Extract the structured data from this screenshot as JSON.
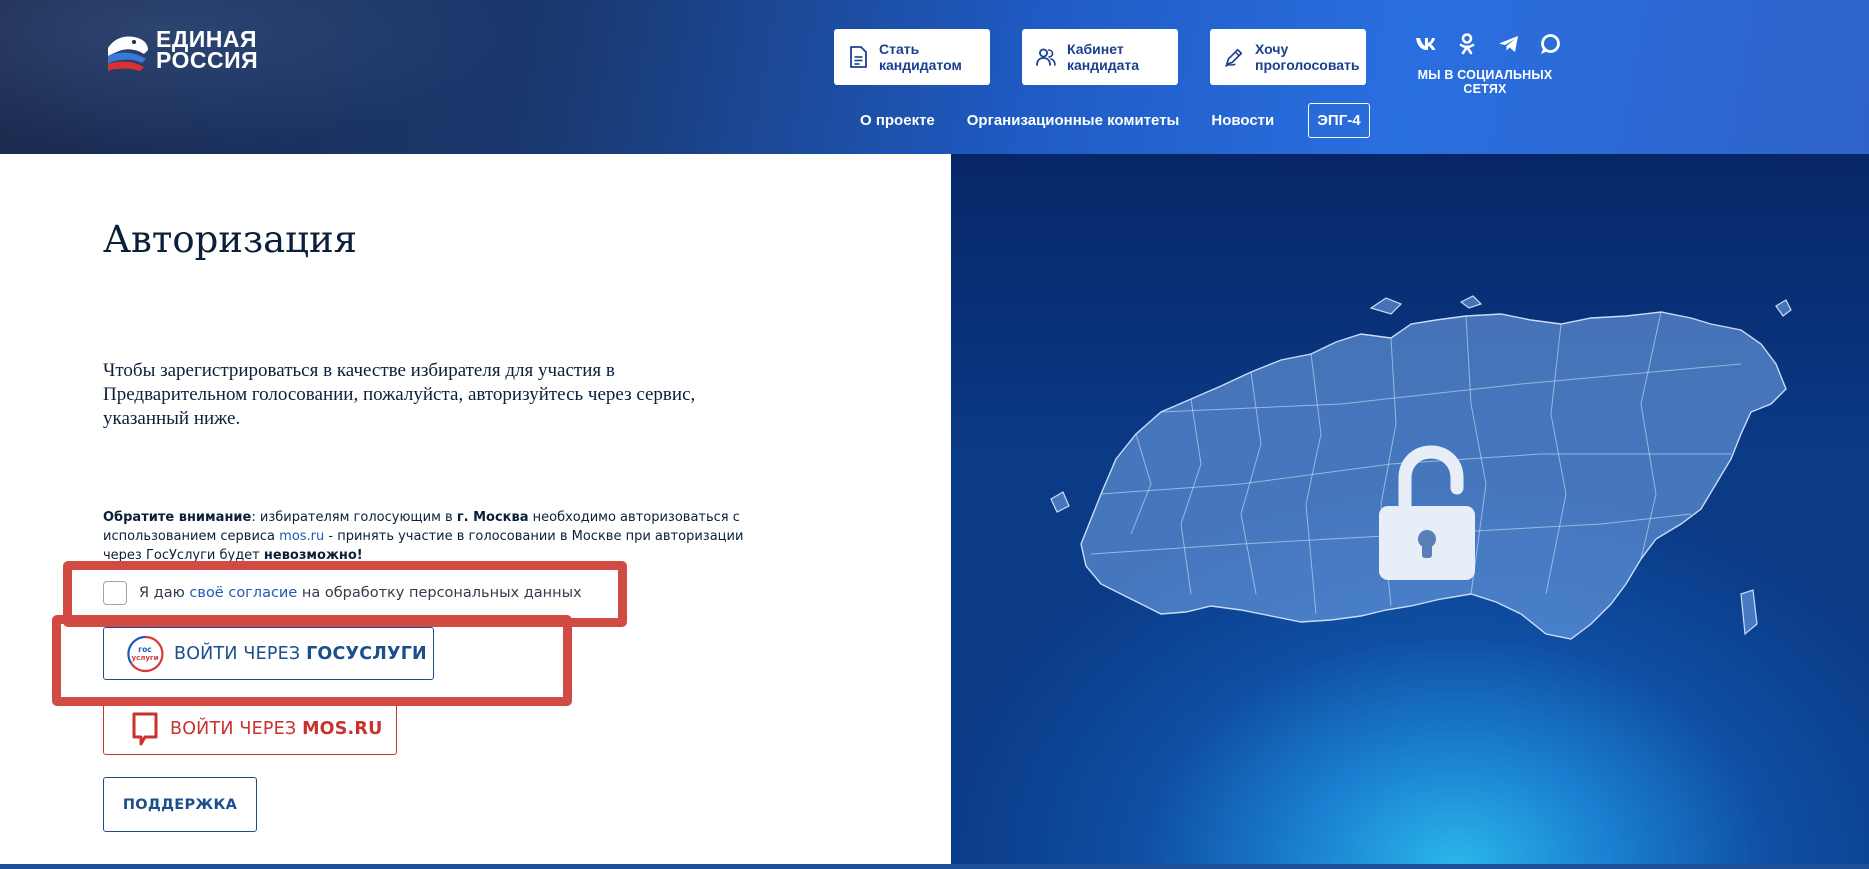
{
  "header": {
    "logo": {
      "line1": "ЕДИНАЯ",
      "line2": "РОССИЯ"
    },
    "buttons": [
      {
        "label": "Стать кандидатом",
        "icon": "document-icon"
      },
      {
        "label": "Кабинет кандидата",
        "icon": "users-icon"
      },
      {
        "label": "Хочу проголосовать",
        "icon": "vote-pen-icon"
      }
    ],
    "social": {
      "label": "МЫ В СОЦИАЛЬНЫХ СЕТЯХ",
      "icons": [
        "vk-icon",
        "odnoklassniki-icon",
        "telegram-icon",
        "chat-icon"
      ]
    },
    "nav": [
      {
        "label": "О проекте"
      },
      {
        "label": "Организационные комитеты"
      },
      {
        "label": "Новости"
      },
      {
        "label": "ЭПГ-4"
      }
    ]
  },
  "main": {
    "title": "Авторизация",
    "intro": "Чтобы зарегистрироваться в качестве избирателя для участия в Предварительном голосовании, пожалуйста, авторизуйтесь через сервис, указанный ниже.",
    "notice": {
      "bold_prefix": "Обратите внимание",
      "part1": ": избирателям голосующим в ",
      "city": "г. Москва",
      "part2": " необходимо авторизоваться с использованием сервиса ",
      "link": "mos.ru",
      "part3": " - принять участие в голосовании в Москве при авторизации через ГосУслуги будет ",
      "bold_suffix": "невозможно!"
    },
    "consent": {
      "prefix": "Я даю ",
      "link": "своё согласие",
      "suffix": " на обработку персональных данных",
      "checked": false
    },
    "gosuslugi_button": {
      "prefix": "ВОЙТИ ЧЕРЕЗ ",
      "brand": "ГОСУСЛУГИ",
      "icon_text_1": "гос",
      "icon_text_2": "услуги"
    },
    "mos_button": {
      "prefix": "ВОЙТИ ЧЕРЕЗ ",
      "brand": "MOS.RU"
    },
    "support_button": {
      "label": "ПОДДЕРЖКА"
    }
  },
  "colors": {
    "brand_blue": "#1b4f8c",
    "mos_red": "#c9322e",
    "link_blue": "#1e5bb8",
    "highlight_red": "#d14a43"
  }
}
